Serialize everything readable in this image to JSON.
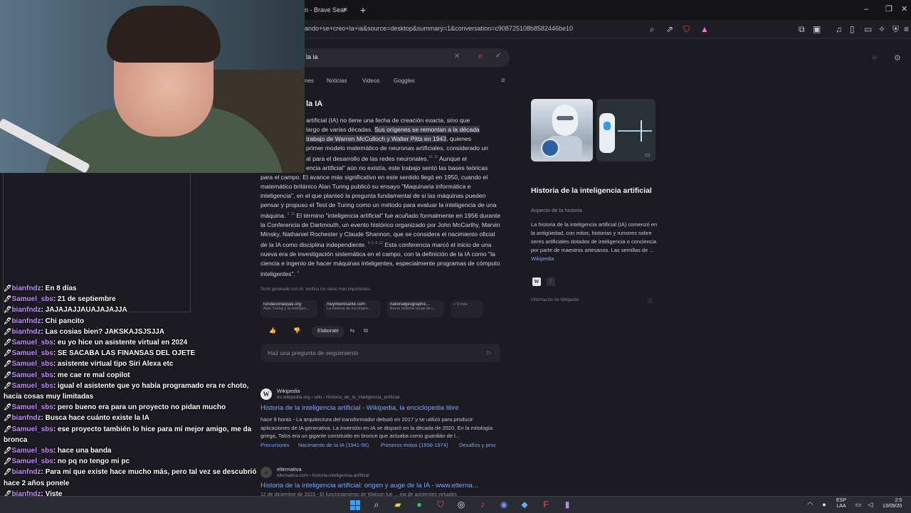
{
  "browser": {
    "tab_title": "n - Brave Sear",
    "tab_close": "×",
    "new_tab": "+",
    "minimize": "–",
    "restore": "❐",
    "close": "✕",
    "url": "ando+se+creo+la+ia&source=desktop&summary=1&conversation=c908725108b8582446be10"
  },
  "search": {
    "query": "la ia",
    "tabs": [
      "nes",
      "Noticias",
      "Videos",
      "Goggles"
    ]
  },
  "ai_answer": {
    "title": "la IA",
    "p1_a": "artificial (IA) no tiene una fecha de creación exacta, sino que",
    "p1_b": "largo de varias décadas. ",
    "p1_hl1": "Sus orígenes se remontan a la década",
    "p1_hl2": "trabajo de Warren McCulloch y Walter Pitts en 1943",
    "p1_c": ", quienes",
    "p1_d": "primer modelo matemático de neuronas artificiales, considerado un",
    "p1_e": "al para el desarrollo de las redes neuronales.",
    "p1_f": " Aunque el",
    "p1_g": "encia artificial\" aún no existía, este trabajo sentó las bases teóricas",
    "p1_h": "para el campo. El avance más significativo en este sentido llegó en 1950, cuando el matemático británico Alan Turing publicó su ensayo \"Maquinaria informática e inteligencia\", en el que planteó la pregunta fundamental de si las máquinas pueden pensar y propuso el Test de Turing como un método para evaluar la inteligencia de una máquina.",
    "p1_i": " El término \"inteligencia artificial\" fue acuñado formalmente en 1956 durante la Conferencia de Dartmouth, un evento histórico organizado por John McCarthy, Marvin Minsky, Nathaniel Rochester y Claude Shannon, que se considera el nacimiento oficial de la IA como disciplina independiente.",
    "p1_j": " Esta conferencia marcó el inicio de una nueva era de investigación sistemática en el campo, con la definición de la IA como \"la ciencia e ingenio de hacer máquinas inteligentes, especialmente programas de cómputo inteligentes\".",
    "refs": [
      "10",
      "11",
      "2",
      "11",
      "4",
      "5",
      "8",
      "12",
      "4"
    ],
    "note": "Texto generado con IA, verifica los datos más importantes.",
    "sources": [
      {
        "title": "fundacionaquae.org",
        "sub": "Alan Turing y la inteligen..."
      },
      {
        "title": "muyinteresante.com",
        "sub": "La historia de los origen..."
      },
      {
        "title": "nationalgeographic...",
        "sub": "Breve historia visual de l..."
      },
      {
        "title": "",
        "sub": "+ 9 más"
      }
    ],
    "elaborate": "Elaborate",
    "followup_placeholder": "Haz una pregunta de seguimiento"
  },
  "results": [
    {
      "site": "Wikipedia",
      "url": "es.wikipedia.org › wiki › Historia_de_la_inteligencia_artificial",
      "title": "Historia de la inteligencia artificial - Wikipedia, la enciclopedia libre",
      "desc": "hace 9 horas - La arquitectura del transformador debutó en 2017 y se utilizó para producir aplicaciones de IA generativa. La inversión en IA se disparó en la década de 2020. En la mitología griega, Talos era un gigante construido en bronce que actuaba como guardián de l...",
      "sitelinks": [
        "Precursores",
        "Nacimiento de la IA (1941-56)",
        "Primeros éxitos (1956-1974)",
        "Desafíos y proc"
      ]
    },
    {
      "site": "elternativa",
      "url": "elternativa.com › historia-inteligencia-artificial",
      "title": "Historia de la inteligencia artificial: origen y auge de la IA - www.elterna...",
      "desc": "12 de diciembre de 2023 - El funcionamiento de Watson fue ... eja de asistentes virtuales"
    }
  ],
  "knowledge_panel": {
    "title": "Historia de la inteligencia artificial",
    "subtitle": "Aspecto de la historia",
    "text": "La historia de la inteligencia artificial (IA) comenzó en la antigüedad, con mitos, historias y rumores sobre seres artificiales dotados de inteligencia o conciencia por parte de maestros artesanos. Las semillas de ... ",
    "link": "Wikipedia",
    "info": "Información de Wikipedia"
  },
  "chat": [
    {
      "user": "bianfndz",
      "msg": "En 8 días"
    },
    {
      "user": "Samuel_sbs",
      "msg": "21 de septiembre"
    },
    {
      "user": "bianfndz",
      "msg": "JAJAJAJJAUAJAJAJJA"
    },
    {
      "user": "bianfndz",
      "msg": "Chi pancito"
    },
    {
      "user": "bianfndz",
      "msg": "Las cosias bien? JAKSKAJSJSJJA"
    },
    {
      "user": "Samuel_sbs",
      "msg": "eu yo hice un asistente virtual en 2024"
    },
    {
      "user": "Samuel_sbs",
      "msg": "SE SACABA LAS FINANSAS DEL OJETE"
    },
    {
      "user": "Samuel_sbs",
      "msg": "asistente virtual tipo Siri Alexa etc"
    },
    {
      "user": "Samuel_sbs",
      "msg": "me cae re mal copilot"
    },
    {
      "user": "Samuel_sbs",
      "msg": "igual el asistente que yo había programado era re choto, hacía cosas muy limitadas"
    },
    {
      "user": "Samuel_sbs",
      "msg": "pero bueno era para un proyecto no pidan mucho"
    },
    {
      "user": "bianfndz",
      "msg": "Busca hace cuánto existe la IA"
    },
    {
      "user": "Samuel_sbs",
      "msg": "ese proyecto también lo hice para mí mejor amigo, me da bronca"
    },
    {
      "user": "Samuel_sbs",
      "msg": "hace una banda"
    },
    {
      "user": "Samuel_sbs",
      "msg": "no pq no tengo mi pc"
    },
    {
      "user": "bianfndz",
      "msg": "Para mí que existe hace mucho más, pero tal vez se descubrió hace 2 años ponele"
    },
    {
      "user": "bianfndz",
      "msg": "Viste"
    }
  ],
  "taskbar": {
    "lang_1": "ESP",
    "lang_2": "LAA",
    "time": "2:5",
    "date": "13/09/20"
  },
  "colors": {
    "accent": "#7aa4ff",
    "chat_user": "#c48cff",
    "brave": "#fb542b"
  }
}
